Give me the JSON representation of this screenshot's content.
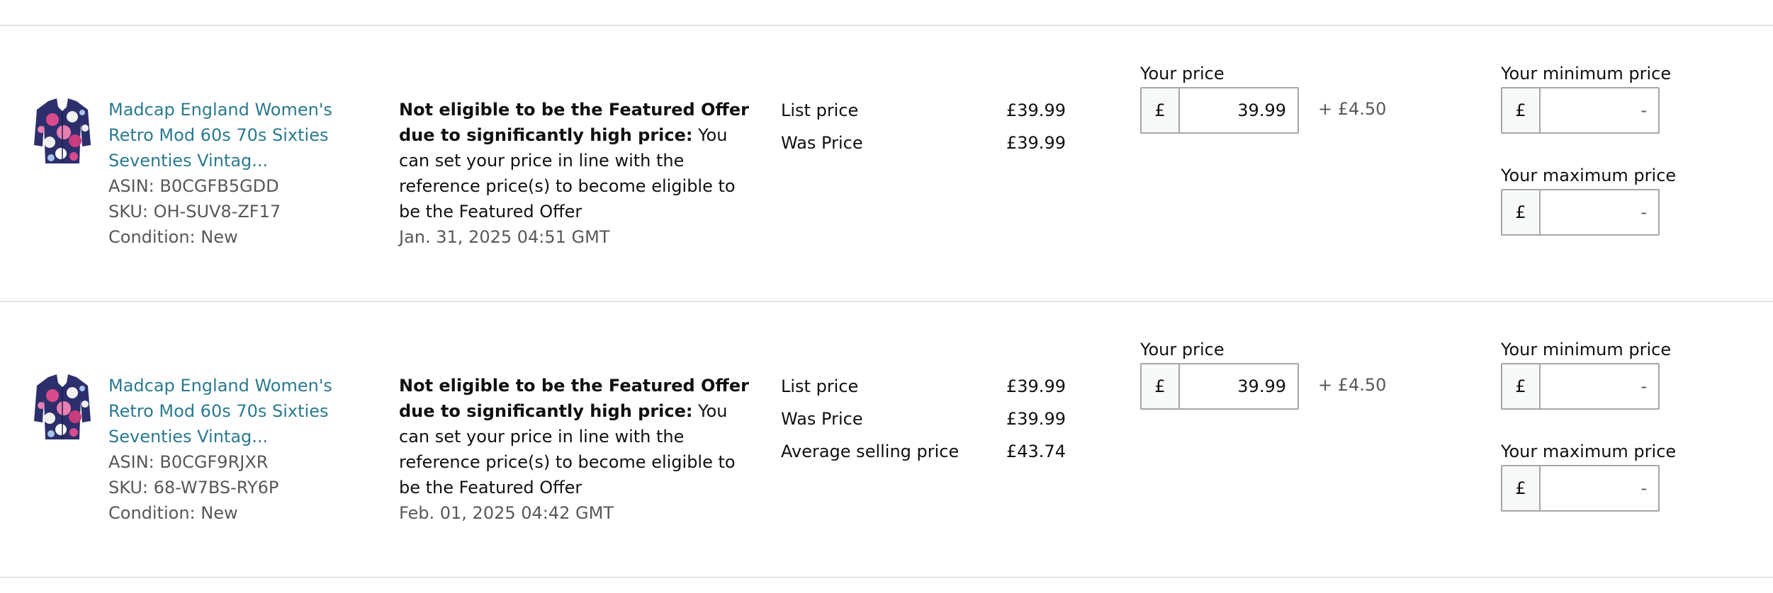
{
  "listings": [
    {
      "title": "Madcap England Women's Retro Mod 60s 70s Sixties Seventies Vintag...",
      "asin": "ASIN: B0CGFB5GDD",
      "sku": "SKU: OH-SUV8-ZF17",
      "condition": "Condition: New",
      "status_bold": "Not eligible to be the Featured Offer due to significantly high price:",
      "status_text": " You can set your price in line with the reference price(s) to become eligible to be the Featured Offer",
      "date": "Jan. 31, 2025 04:51 GMT",
      "prices": [
        {
          "label": "List price",
          "value": "£39.99"
        },
        {
          "label": "Was Price",
          "value": "£39.99"
        }
      ],
      "your_price_label": "Your price",
      "currency": "£",
      "your_price_value": "39.99",
      "shipping": "+ £4.50",
      "min_label": "Your minimum price",
      "min_placeholder": "-",
      "max_label": "Your maximum price",
      "max_placeholder": "-"
    },
    {
      "title": "Madcap England Women's Retro Mod 60s 70s Sixties Seventies Vintag...",
      "asin": "ASIN: B0CGF9RJXR",
      "sku": "SKU: 68-W7BS-RY6P",
      "condition": "Condition: New",
      "status_bold": "Not eligible to be the Featured Offer due to significantly high price:",
      "status_text": " You can set your price in line with the reference price(s) to become eligible to be the Featured Offer",
      "date": "Feb. 01, 2025 04:42 GMT",
      "prices": [
        {
          "label": "List price",
          "value": "£39.99"
        },
        {
          "label": "Was Price",
          "value": "£39.99"
        },
        {
          "label": "Average selling price",
          "value": "£43.74"
        }
      ],
      "your_price_label": "Your price",
      "currency": "£",
      "your_price_value": "39.99",
      "shipping": "+ £4.50",
      "min_label": "Your minimum price",
      "min_placeholder": "-",
      "max_label": "Your maximum price",
      "max_placeholder": "-"
    }
  ]
}
